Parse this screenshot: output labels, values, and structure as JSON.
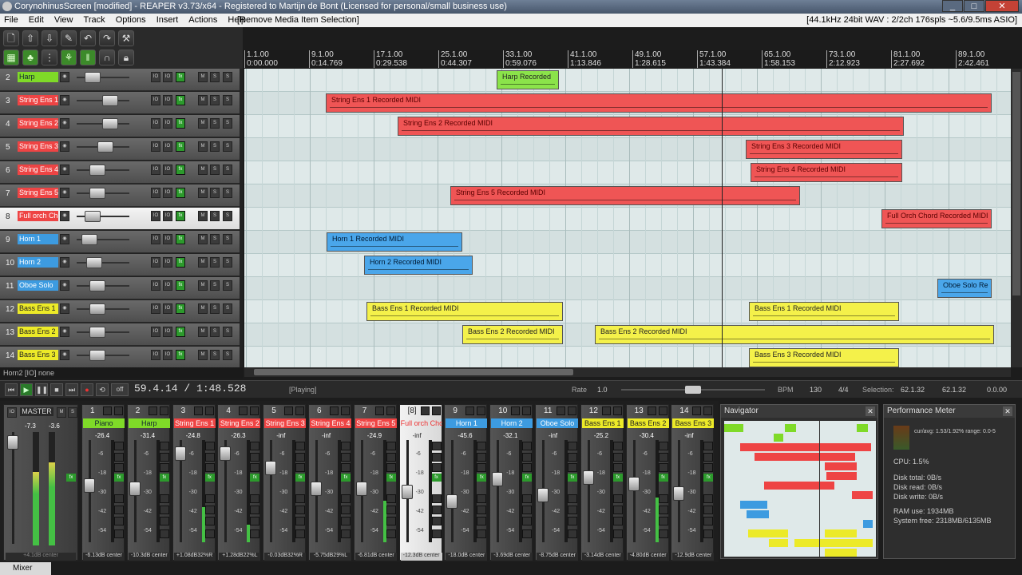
{
  "window": {
    "title": "CorynohinusScreen [modified] - REAPER v3.73/x64 - Registered to Martijn de Bont (Licensed for personal/small business use)"
  },
  "menu": {
    "items": [
      "File",
      "Edit",
      "View",
      "Track",
      "Options",
      "Insert",
      "Actions",
      "Help"
    ],
    "action_label": "[Remove Media Item Selection]",
    "status": "[44.1kHz 24bit WAV : 2/2ch 176spls ~5.6/9.5ms ASIO]"
  },
  "ruler": {
    "marks": [
      {
        "bar": "1.1.00",
        "time": "0:00.000"
      },
      {
        "bar": "9.1.00",
        "time": "0:14.769"
      },
      {
        "bar": "17.1.00",
        "time": "0:29.538"
      },
      {
        "bar": "25.1.00",
        "time": "0:44.307"
      },
      {
        "bar": "33.1.00",
        "time": "0:59.076"
      },
      {
        "bar": "41.1.00",
        "time": "1:13.846"
      },
      {
        "bar": "49.1.00",
        "time": "1:28.615"
      },
      {
        "bar": "57.1.00",
        "time": "1:43.384"
      },
      {
        "bar": "65.1.00",
        "time": "1:58.153"
      },
      {
        "bar": "73.1.00",
        "time": "2:12.923"
      },
      {
        "bar": "81.1.00",
        "time": "2:27.692"
      },
      {
        "bar": "89.1.00",
        "time": "2:42.461"
      }
    ]
  },
  "tracks": [
    {
      "num": "2",
      "name": "Harp",
      "color": "green"
    },
    {
      "num": "3",
      "name": "String Ens 1",
      "color": "red"
    },
    {
      "num": "4",
      "name": "String Ens 2",
      "color": "red"
    },
    {
      "num": "5",
      "name": "String Ens 3",
      "color": "red"
    },
    {
      "num": "6",
      "name": "String Ens 4",
      "color": "red"
    },
    {
      "num": "7",
      "name": "String Ens 5",
      "color": "red"
    },
    {
      "num": "8",
      "name": "Full orch Chor",
      "color": "red"
    },
    {
      "num": "9",
      "name": "Horn 1",
      "color": "blue"
    },
    {
      "num": "10",
      "name": "Horn 2",
      "color": "blue"
    },
    {
      "num": "11",
      "name": "Oboe Solo",
      "color": "blue"
    },
    {
      "num": "12",
      "name": "Bass Ens 1",
      "color": "yellow"
    },
    {
      "num": "13",
      "name": "Bass Ens 2",
      "color": "yellow"
    },
    {
      "num": "14",
      "name": "Bass Ens 3",
      "color": "yellow"
    }
  ],
  "track_buttons": {
    "rec": "◉",
    "io": "IO",
    "fx": "fx",
    "mute": "M",
    "solo": "S"
  },
  "items": [
    {
      "label": "Harp Recorded",
      "color": "green"
    },
    {
      "label": "String Ens 1 Recorded MIDI",
      "color": "red"
    },
    {
      "label": "String Ens 2 Recorded MIDI",
      "color": "red"
    },
    {
      "label": "String Ens 3 Recorded MIDI",
      "color": "red"
    },
    {
      "label": "String Ens 4 Recorded MIDI",
      "color": "red"
    },
    {
      "label": "String Ens 5 Recorded MIDI",
      "color": "red"
    },
    {
      "label": "Full Orch Chord Recorded MIDI",
      "color": "red"
    },
    {
      "label": "Horn 1 Recorded MIDI",
      "color": "blue"
    },
    {
      "label": "Horn 2 Recorded MIDI",
      "color": "blue"
    },
    {
      "label": "Oboe Solo Re",
      "color": "blue"
    },
    {
      "label": "Bass Ens 1 Recorded MIDI",
      "color": "yellow"
    },
    {
      "label": "Bass Ens 1 Recorded MIDI",
      "color": "yellow"
    },
    {
      "label": "Bass Ens 2 Recorded MIDI",
      "color": "yellow"
    },
    {
      "label": "Bass Ens 2 Recorded MIDI",
      "color": "yellow"
    },
    {
      "label": "Bass Ens 3 Recorded MIDI",
      "color": "yellow"
    }
  ],
  "tcp_status": "Horn2 [IO] none",
  "transport": {
    "time": "59.4.14 / 1:48.528",
    "state": "[Playing]",
    "rate_label": "Rate",
    "rate": "1.0",
    "bpm_label": "BPM",
    "bpm": "130",
    "sig": "4/4",
    "sel_label": "Selection:",
    "sel_start": "62.1.32",
    "sel_end": "62.1.32",
    "sel_len": "0.0.00",
    "off_label": "off"
  },
  "mixer": {
    "master": {
      "name": "MASTER",
      "peak_l": "-7.3",
      "peak_r": "-3.6",
      "pan": "+4.1dB center"
    },
    "strips": [
      {
        "num": "1",
        "name": "Piano",
        "color": "green",
        "peak": "-26.4",
        "pan": "-6.13dB center"
      },
      {
        "num": "2",
        "name": "Harp",
        "color": "green",
        "peak": "-31.4",
        "pan": "-10.3dB center"
      },
      {
        "num": "3",
        "name": "String Ens 1",
        "color": "red",
        "peak": "-24.8",
        "pan": "+1.08dB32%R"
      },
      {
        "num": "4",
        "name": "String Ens 2",
        "color": "red",
        "peak": "-26.3",
        "pan": "+1.28dB22%L"
      },
      {
        "num": "5",
        "name": "String Ens 3",
        "color": "red",
        "peak": "-inf",
        "pan": "-0.03dB32%R"
      },
      {
        "num": "6",
        "name": "String Ens 4",
        "color": "red",
        "peak": "-inf",
        "pan": "-5.75dB29%L"
      },
      {
        "num": "7",
        "name": "String Ens 5",
        "color": "red",
        "peak": "-24.9",
        "pan": "-6.81dB center"
      },
      {
        "num": "[8]",
        "name": "Full orch Chor",
        "color": "white",
        "peak": "-inf",
        "pan": "-12.3dB center"
      },
      {
        "num": "9",
        "name": "Horn 1",
        "color": "blue",
        "peak": "-45.6",
        "pan": "-18.0dB center"
      },
      {
        "num": "10",
        "name": "Horn 2",
        "color": "blue",
        "peak": "-32.1",
        "pan": "-3.69dB center"
      },
      {
        "num": "11",
        "name": "Oboe Solo",
        "color": "blue",
        "peak": "-inf",
        "pan": "-8.75dB center"
      },
      {
        "num": "12",
        "name": "Bass Ens 1",
        "color": "yellow",
        "peak": "-25.2",
        "pan": "-3.14dB center"
      },
      {
        "num": "13",
        "name": "Bass Ens 2",
        "color": "yellow",
        "peak": "-30.4",
        "pan": "-4.80dB center"
      },
      {
        "num": "14",
        "name": "Bass Ens 3",
        "color": "yellow",
        "peak": "-inf",
        "pan": "-12.9dB center"
      }
    ],
    "scale": [
      "-6",
      "-18",
      "-30",
      "-42",
      "-54"
    ],
    "tab": "Mixer"
  },
  "navigator": {
    "title": "Navigator"
  },
  "perf": {
    "title": "Performance Meter",
    "avg": "cur/avg: 1.53/1.92%  range: 0.0-5",
    "cpu": "CPU: 1.5%",
    "disk_total": "Disk total: 0B/s",
    "disk_read": "Disk read: 0B/s",
    "disk_write": "Disk write: 0B/s",
    "ram": "RAM use: 1934MB",
    "sysfree": "System free: 2318MB/6135MB"
  },
  "colors": {
    "green": "#7fda28",
    "red": "#ee4444",
    "blue": "#3d9be0",
    "yellow": "#ecea28"
  }
}
